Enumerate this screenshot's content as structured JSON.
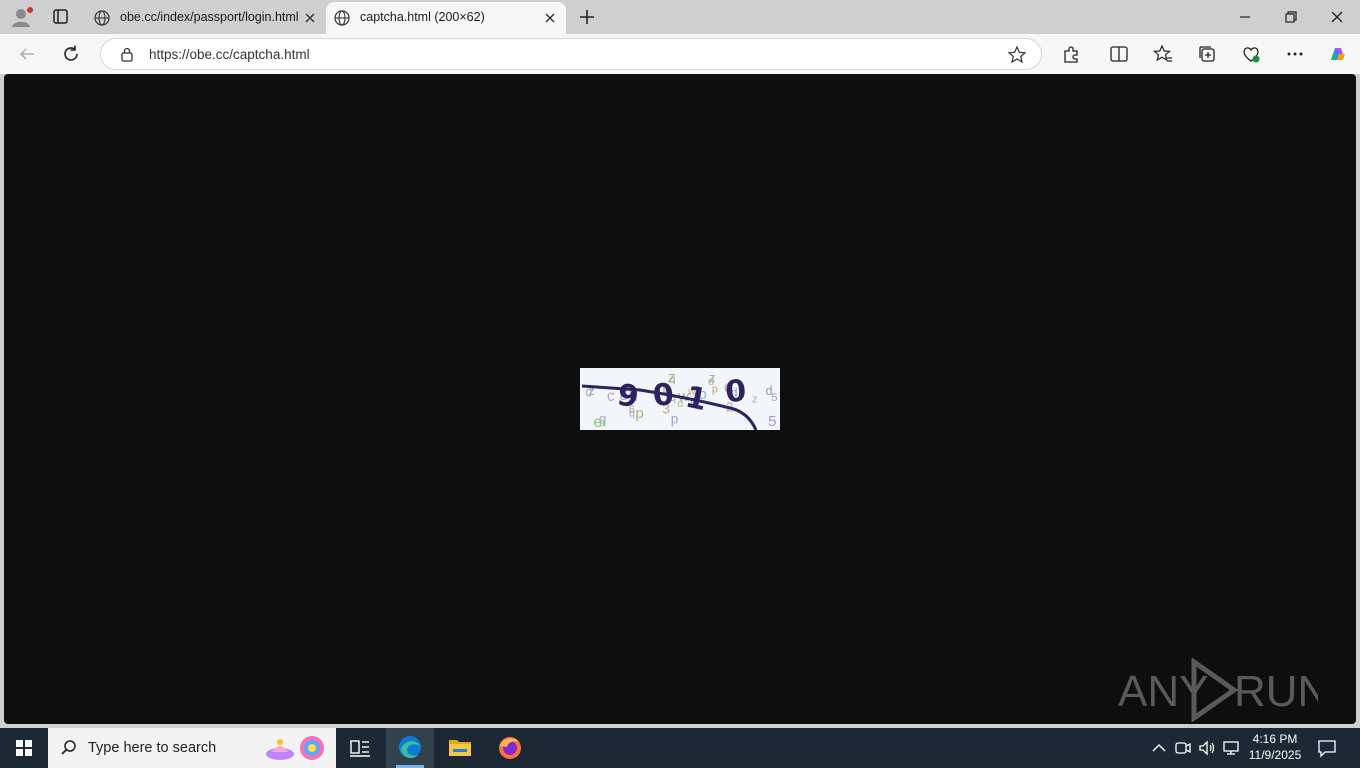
{
  "tabs": [
    {
      "title": "obe.cc/index/passport/login.html",
      "active": false
    },
    {
      "title": "captcha.html (200×62)",
      "active": true
    }
  ],
  "address_bar": {
    "url": "https://obe.cc/captcha.html"
  },
  "captcha": {
    "code": [
      "9",
      "0",
      "1",
      "0"
    ],
    "noise": [
      "d",
      "d",
      "q",
      "t",
      "z",
      "6",
      "q",
      "e",
      "c",
      "d",
      "p",
      "5",
      "w",
      "d",
      "a",
      "z",
      "b",
      "d",
      "q",
      "3",
      "d",
      "w",
      "q",
      "q",
      "p",
      "5",
      "2",
      "z",
      "J",
      "d",
      "c",
      "z",
      "p"
    ]
  },
  "watermark": {
    "text": "ANY",
    "text2": "RUN"
  },
  "taskbar": {
    "search_placeholder": "Type here to search",
    "time": "4:16 PM",
    "date": "11/9/2025"
  },
  "colors": {
    "captcha_ink": "#2e2360",
    "page_bg": "#0e0e0e",
    "taskbar_bg": "#1c2833"
  }
}
